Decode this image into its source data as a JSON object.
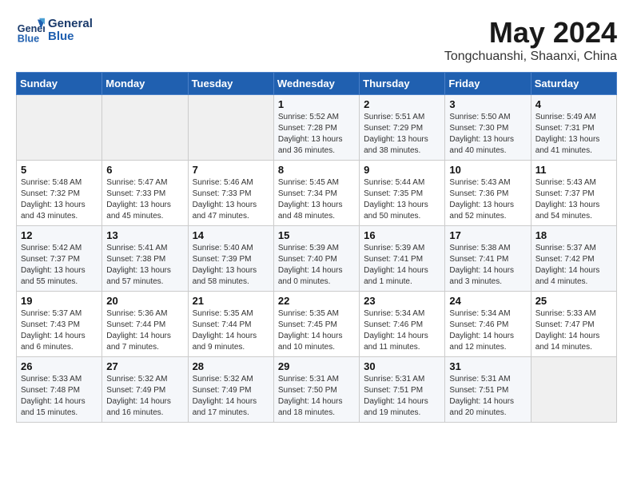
{
  "header": {
    "logo_line1": "General",
    "logo_line2": "Blue",
    "month": "May 2024",
    "location": "Tongchuanshi, Shaanxi, China"
  },
  "days_of_week": [
    "Sunday",
    "Monday",
    "Tuesday",
    "Wednesday",
    "Thursday",
    "Friday",
    "Saturday"
  ],
  "weeks": [
    [
      {
        "day": "",
        "info": ""
      },
      {
        "day": "",
        "info": ""
      },
      {
        "day": "",
        "info": ""
      },
      {
        "day": "1",
        "info": "Sunrise: 5:52 AM\nSunset: 7:28 PM\nDaylight: 13 hours\nand 36 minutes."
      },
      {
        "day": "2",
        "info": "Sunrise: 5:51 AM\nSunset: 7:29 PM\nDaylight: 13 hours\nand 38 minutes."
      },
      {
        "day": "3",
        "info": "Sunrise: 5:50 AM\nSunset: 7:30 PM\nDaylight: 13 hours\nand 40 minutes."
      },
      {
        "day": "4",
        "info": "Sunrise: 5:49 AM\nSunset: 7:31 PM\nDaylight: 13 hours\nand 41 minutes."
      }
    ],
    [
      {
        "day": "5",
        "info": "Sunrise: 5:48 AM\nSunset: 7:32 PM\nDaylight: 13 hours\nand 43 minutes."
      },
      {
        "day": "6",
        "info": "Sunrise: 5:47 AM\nSunset: 7:33 PM\nDaylight: 13 hours\nand 45 minutes."
      },
      {
        "day": "7",
        "info": "Sunrise: 5:46 AM\nSunset: 7:33 PM\nDaylight: 13 hours\nand 47 minutes."
      },
      {
        "day": "8",
        "info": "Sunrise: 5:45 AM\nSunset: 7:34 PM\nDaylight: 13 hours\nand 48 minutes."
      },
      {
        "day": "9",
        "info": "Sunrise: 5:44 AM\nSunset: 7:35 PM\nDaylight: 13 hours\nand 50 minutes."
      },
      {
        "day": "10",
        "info": "Sunrise: 5:43 AM\nSunset: 7:36 PM\nDaylight: 13 hours\nand 52 minutes."
      },
      {
        "day": "11",
        "info": "Sunrise: 5:43 AM\nSunset: 7:37 PM\nDaylight: 13 hours\nand 54 minutes."
      }
    ],
    [
      {
        "day": "12",
        "info": "Sunrise: 5:42 AM\nSunset: 7:37 PM\nDaylight: 13 hours\nand 55 minutes."
      },
      {
        "day": "13",
        "info": "Sunrise: 5:41 AM\nSunset: 7:38 PM\nDaylight: 13 hours\nand 57 minutes."
      },
      {
        "day": "14",
        "info": "Sunrise: 5:40 AM\nSunset: 7:39 PM\nDaylight: 13 hours\nand 58 minutes."
      },
      {
        "day": "15",
        "info": "Sunrise: 5:39 AM\nSunset: 7:40 PM\nDaylight: 14 hours\nand 0 minutes."
      },
      {
        "day": "16",
        "info": "Sunrise: 5:39 AM\nSunset: 7:41 PM\nDaylight: 14 hours\nand 1 minute."
      },
      {
        "day": "17",
        "info": "Sunrise: 5:38 AM\nSunset: 7:41 PM\nDaylight: 14 hours\nand 3 minutes."
      },
      {
        "day": "18",
        "info": "Sunrise: 5:37 AM\nSunset: 7:42 PM\nDaylight: 14 hours\nand 4 minutes."
      }
    ],
    [
      {
        "day": "19",
        "info": "Sunrise: 5:37 AM\nSunset: 7:43 PM\nDaylight: 14 hours\nand 6 minutes."
      },
      {
        "day": "20",
        "info": "Sunrise: 5:36 AM\nSunset: 7:44 PM\nDaylight: 14 hours\nand 7 minutes."
      },
      {
        "day": "21",
        "info": "Sunrise: 5:35 AM\nSunset: 7:44 PM\nDaylight: 14 hours\nand 9 minutes."
      },
      {
        "day": "22",
        "info": "Sunrise: 5:35 AM\nSunset: 7:45 PM\nDaylight: 14 hours\nand 10 minutes."
      },
      {
        "day": "23",
        "info": "Sunrise: 5:34 AM\nSunset: 7:46 PM\nDaylight: 14 hours\nand 11 minutes."
      },
      {
        "day": "24",
        "info": "Sunrise: 5:34 AM\nSunset: 7:46 PM\nDaylight: 14 hours\nand 12 minutes."
      },
      {
        "day": "25",
        "info": "Sunrise: 5:33 AM\nSunset: 7:47 PM\nDaylight: 14 hours\nand 14 minutes."
      }
    ],
    [
      {
        "day": "26",
        "info": "Sunrise: 5:33 AM\nSunset: 7:48 PM\nDaylight: 14 hours\nand 15 minutes."
      },
      {
        "day": "27",
        "info": "Sunrise: 5:32 AM\nSunset: 7:49 PM\nDaylight: 14 hours\nand 16 minutes."
      },
      {
        "day": "28",
        "info": "Sunrise: 5:32 AM\nSunset: 7:49 PM\nDaylight: 14 hours\nand 17 minutes."
      },
      {
        "day": "29",
        "info": "Sunrise: 5:31 AM\nSunset: 7:50 PM\nDaylight: 14 hours\nand 18 minutes."
      },
      {
        "day": "30",
        "info": "Sunrise: 5:31 AM\nSunset: 7:51 PM\nDaylight: 14 hours\nand 19 minutes."
      },
      {
        "day": "31",
        "info": "Sunrise: 5:31 AM\nSunset: 7:51 PM\nDaylight: 14 hours\nand 20 minutes."
      },
      {
        "day": "",
        "info": ""
      }
    ]
  ]
}
